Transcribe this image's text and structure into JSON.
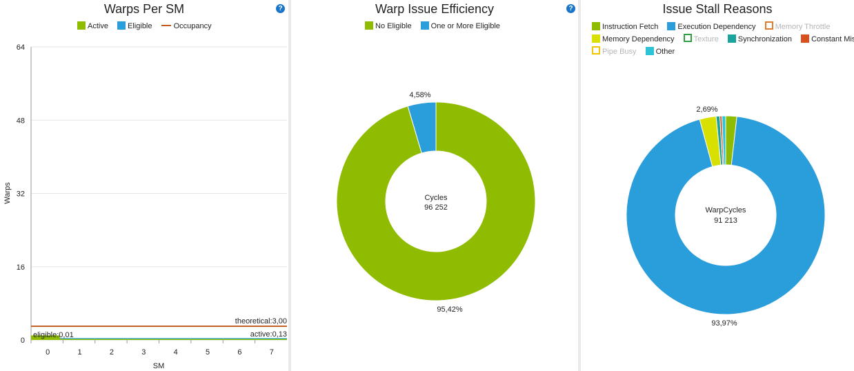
{
  "chart_data": [
    {
      "type": "bar",
      "title": "Warps Per SM",
      "xlabel": "SM",
      "ylabel": "Warps",
      "categories": [
        "0",
        "1",
        "2",
        "3",
        "4",
        "5",
        "6",
        "7"
      ],
      "yticks": [
        "0",
        "16",
        "32",
        "48",
        "64"
      ],
      "ylim": [
        0,
        64
      ],
      "grid": true,
      "legend_position": "top",
      "series": [
        {
          "name": "Active",
          "color": "#8fbc00",
          "values": [
            0.13,
            0.13,
            0.13,
            0.13,
            0.13,
            0.13,
            0.13,
            0.13
          ],
          "annotation": "active:0,13"
        },
        {
          "name": "Eligible",
          "color": "#2a9ddb",
          "values": [
            0.01,
            0.01,
            0.01,
            0.01,
            0.01,
            0.01,
            0.01,
            0.01
          ],
          "annotation": "eligible:0,01"
        },
        {
          "name": "Occupancy",
          "color": "#c05a1c",
          "type": "line",
          "value": 3.0,
          "annotation": "theoretical:3,00"
        }
      ],
      "green_bar_sm0": 1.0
    },
    {
      "type": "pie",
      "donut": true,
      "title": "Warp Issue Efficiency",
      "center_label": "Cycles",
      "center_value": "96 252",
      "legend_position": "top",
      "slices": [
        {
          "name": "No Eligible",
          "value": 95.42,
          "label": "95,42%",
          "color": "#8fbc00"
        },
        {
          "name": "One or More Eligible",
          "value": 4.58,
          "label": "4,58%",
          "color": "#2a9ddb"
        }
      ]
    },
    {
      "type": "pie",
      "donut": true,
      "title": "Issue Stall Reasons",
      "center_label": "WarpCycles",
      "center_value": "91 213",
      "legend_position": "top",
      "legend": [
        {
          "name": "Instruction Fetch",
          "color": "#8fbc00",
          "visible": true
        },
        {
          "name": "Execution Dependency",
          "color": "#2a9ddb",
          "visible": true
        },
        {
          "name": "Memory Throttle",
          "color": "#e07b2a",
          "visible": false
        },
        {
          "name": "Memory Dependency",
          "color": "#d8e000",
          "visible": true
        },
        {
          "name": "Texture",
          "color": "#2e9e44",
          "visible": false
        },
        {
          "name": "Synchronization",
          "color": "#1aa39a",
          "visible": true
        },
        {
          "name": "Constant Miss",
          "color": "#d9501e",
          "visible": true
        },
        {
          "name": "Pipe Busy",
          "color": "#f0c800",
          "visible": false
        },
        {
          "name": "Other",
          "color": "#2ec4d6",
          "visible": true
        }
      ],
      "slices": [
        {
          "name": "Instruction Fetch",
          "value": 1.8,
          "label": "",
          "color": "#8fbc00"
        },
        {
          "name": "Execution Dependency",
          "value": 93.97,
          "label": "93,97%",
          "color": "#2a9ddb"
        },
        {
          "name": "Memory Dependency",
          "value": 2.69,
          "label": "2,69%",
          "color": "#d8e000"
        },
        {
          "name": "Synchronization",
          "value": 0.6,
          "label": "",
          "color": "#1aa39a"
        },
        {
          "name": "Constant Miss",
          "value": 0.34,
          "label": "",
          "color": "#d9501e"
        },
        {
          "name": "Other",
          "value": 0.6,
          "label": "",
          "color": "#2ec4d6"
        }
      ]
    }
  ],
  "help_glyph": "?"
}
